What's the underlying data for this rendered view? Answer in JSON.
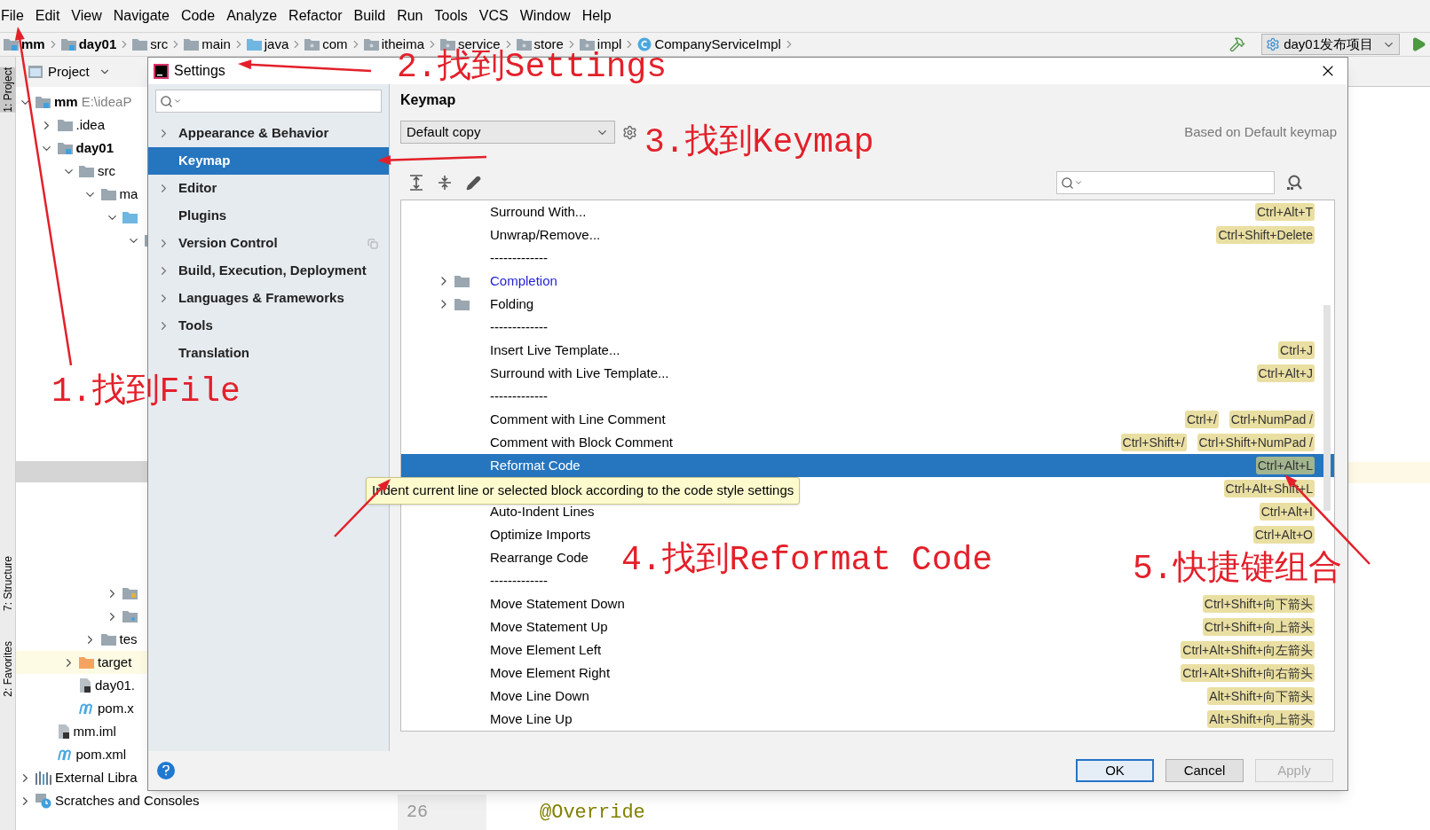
{
  "menu_bar": [
    "File",
    "Edit",
    "View",
    "Navigate",
    "Code",
    "Analyze",
    "Refactor",
    "Build",
    "Run",
    "Tools",
    "VCS",
    "Window",
    "Help"
  ],
  "breadcrumbs": [
    {
      "label": "mm",
      "kind": "module",
      "bold": true
    },
    {
      "label": "day01",
      "kind": "module",
      "bold": true
    },
    {
      "label": "src",
      "kind": "folder",
      "bold": false
    },
    {
      "label": "main",
      "kind": "folder",
      "bold": false
    },
    {
      "label": "java",
      "kind": "source-folder",
      "bold": false
    },
    {
      "label": "com",
      "kind": "package",
      "bold": false
    },
    {
      "label": "itheima",
      "kind": "package",
      "bold": false
    },
    {
      "label": "service",
      "kind": "package",
      "bold": false
    },
    {
      "label": "store",
      "kind": "package",
      "bold": false
    },
    {
      "label": "impl",
      "kind": "package",
      "bold": false
    },
    {
      "label": "CompanyServiceImpl",
      "kind": "class",
      "bold": false
    }
  ],
  "run_config": {
    "label": "day01发布项目"
  },
  "tool_strip": [
    {
      "label": "1: Project",
      "selected": true
    },
    {
      "label": "7: Structure",
      "selected": false
    },
    {
      "label": "2: Favorites",
      "selected": false
    }
  ],
  "project_panel": {
    "title": "Project",
    "tree": [
      {
        "label": "mm",
        "path": "E:\\ideaP",
        "kind": "module",
        "bold": true,
        "expanded": true,
        "children": [
          {
            "label": ".idea",
            "kind": "folder",
            "expanded": false
          },
          {
            "label": "day01",
            "kind": "module",
            "bold": true,
            "expanded": true,
            "children": [
              {
                "label": "src",
                "kind": "folder",
                "expanded": true,
                "children": [
                  {
                    "label": "ma",
                    "kind": "folder",
                    "expanded": true,
                    "children": [
                      {
                        "kind": "source-folder",
                        "expanded": true,
                        "children": [
                          {
                            "kind": "package",
                            "expanded": true
                          }
                        ]
                      },
                      {
                        "kind": "resources",
                        "expanded": false
                      },
                      {
                        "kind": "web-folder",
                        "expanded": false
                      }
                    ]
                  },
                  {
                    "label": "tes",
                    "kind": "folder",
                    "expanded": false
                  }
                ]
              },
              {
                "label": "target",
                "kind": "excluded",
                "expanded": false,
                "highlighted": true
              },
              {
                "label": "day01.",
                "kind": "iml"
              },
              {
                "label": "pom.x",
                "kind": "maven"
              }
            ]
          },
          {
            "label": "mm.iml",
            "kind": "iml"
          },
          {
            "label": "pom.xml",
            "kind": "maven"
          }
        ]
      },
      {
        "label": "External Libra",
        "kind": "library",
        "expanded": false
      },
      {
        "label": "Scratches and Consoles",
        "kind": "scratches",
        "expanded": false
      }
    ]
  },
  "editor": {
    "line_number": "26",
    "code": "@Override"
  },
  "settings_dialog": {
    "title": "Settings",
    "nav": [
      {
        "label": "Appearance & Behavior",
        "expandable": true,
        "selected": false,
        "project_level": false
      },
      {
        "label": "Keymap",
        "expandable": false,
        "selected": true,
        "project_level": false
      },
      {
        "label": "Editor",
        "expandable": true,
        "selected": false,
        "project_level": false
      },
      {
        "label": "Plugins",
        "expandable": false,
        "selected": false,
        "project_level": false
      },
      {
        "label": "Version Control",
        "expandable": true,
        "selected": false,
        "project_level": true
      },
      {
        "label": "Build, Execution, Deployment",
        "expandable": true,
        "selected": false,
        "project_level": false
      },
      {
        "label": "Languages & Frameworks",
        "expandable": true,
        "selected": false,
        "project_level": false
      },
      {
        "label": "Tools",
        "expandable": true,
        "selected": false,
        "project_level": false
      },
      {
        "label": "Translation",
        "expandable": false,
        "selected": false,
        "project_level": false
      }
    ],
    "page_title": "Keymap",
    "keymap": "Default copy",
    "based_on": "Based on Default keymap",
    "actions": [
      {
        "kind": "action",
        "label": "Surround With...",
        "shortcuts": [
          "Ctrl+Alt+T"
        ],
        "selected": false
      },
      {
        "kind": "action",
        "label": "Unwrap/Remove...",
        "shortcuts": [
          "Ctrl+Shift+Delete"
        ],
        "selected": false
      },
      {
        "kind": "separator",
        "label": "-------------",
        "selected": false
      },
      {
        "kind": "group",
        "label": "Completion",
        "expanded": false,
        "modified": true,
        "selected": false
      },
      {
        "kind": "group",
        "label": "Folding",
        "expanded": false,
        "modified": false,
        "selected": false
      },
      {
        "kind": "separator",
        "label": "-------------",
        "selected": false
      },
      {
        "kind": "action",
        "label": "Insert Live Template...",
        "shortcuts": [
          "Ctrl+J"
        ],
        "selected": false
      },
      {
        "kind": "action",
        "label": "Surround with Live Template...",
        "shortcuts": [
          "Ctrl+Alt+J"
        ],
        "selected": false
      },
      {
        "kind": "separator",
        "label": "-------------",
        "selected": false
      },
      {
        "kind": "action",
        "label": "Comment with Line Comment",
        "shortcuts": [
          "Ctrl+/",
          "Ctrl+NumPad /"
        ],
        "selected": false
      },
      {
        "kind": "action",
        "label": "Comment with Block Comment",
        "shortcuts": [
          "Ctrl+Shift+/",
          "Ctrl+Shift+NumPad /"
        ],
        "selected": false
      },
      {
        "kind": "action",
        "label": "Reformat Code",
        "shortcuts": [
          "Ctrl+Alt+L"
        ],
        "selected": true
      },
      {
        "kind": "action",
        "shortcuts": [
          "Ctrl+Alt+Shift+L"
        ],
        "selected": false
      },
      {
        "kind": "action",
        "label": "Auto-Indent Lines",
        "shortcuts": [
          "Ctrl+Alt+I"
        ],
        "selected": false
      },
      {
        "kind": "action",
        "label": "Optimize Imports",
        "shortcuts": [
          "Ctrl+Alt+O"
        ],
        "selected": false
      },
      {
        "kind": "action",
        "label": "Rearrange Code",
        "selected": false
      },
      {
        "kind": "separator",
        "label": "-------------",
        "selected": false
      },
      {
        "kind": "action",
        "label": "Move Statement Down",
        "shortcuts": [
          "Ctrl+Shift+向下箭头"
        ],
        "selected": false
      },
      {
        "kind": "action",
        "label": "Move Statement Up",
        "shortcuts": [
          "Ctrl+Shift+向上箭头"
        ],
        "selected": false
      },
      {
        "kind": "action",
        "label": "Move Element Left",
        "shortcuts": [
          "Ctrl+Alt+Shift+向左箭头"
        ],
        "selected": false
      },
      {
        "kind": "action",
        "label": "Move Element Right",
        "shortcuts": [
          "Ctrl+Alt+Shift+向右箭头"
        ],
        "selected": false
      },
      {
        "kind": "action",
        "label": "Move Line Down",
        "shortcuts": [
          "Alt+Shift+向下箭头"
        ],
        "selected": false
      },
      {
        "kind": "action",
        "label": "Move Line Up",
        "shortcuts": [
          "Alt+Shift+向上箭头"
        ],
        "selected": false
      }
    ],
    "tooltip": "Indent current line or selected block according to the code style settings",
    "buttons": [
      {
        "label": "OK",
        "default": true,
        "disabled": false
      },
      {
        "label": "Cancel",
        "default": false,
        "disabled": false
      },
      {
        "label": "Apply",
        "default": false,
        "disabled": true
      }
    ]
  },
  "annotations": [
    {
      "text": "1.找到File"
    },
    {
      "text": "2.找到Settings"
    },
    {
      "text": "3.找到Keymap"
    },
    {
      "text": "4.找到Reformat Code"
    },
    {
      "text": "5.快捷键组合"
    }
  ]
}
